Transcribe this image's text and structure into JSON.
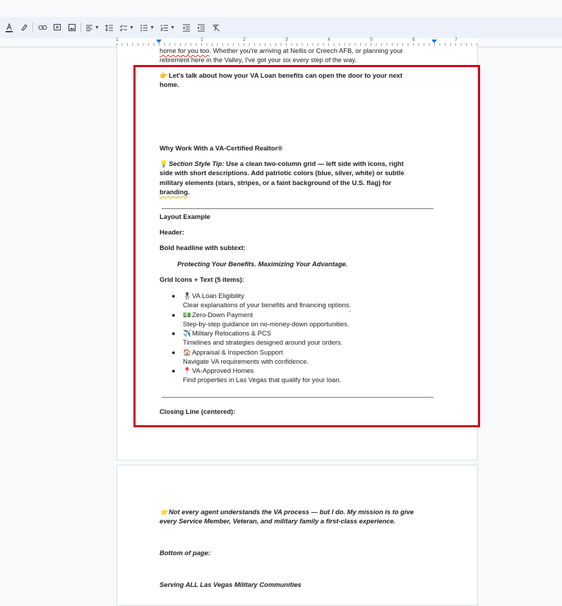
{
  "toolbar": {
    "items": [
      "text-color",
      "highlight",
      "link",
      "comment",
      "image",
      "align",
      "line-spacing",
      "checklist",
      "bulleted-list",
      "numbered-list",
      "decrease-indent",
      "increase-indent",
      "clear-formatting"
    ]
  },
  "ruler": {
    "numbers": [
      "1",
      "1",
      "2",
      "3",
      "4",
      "5",
      "6",
      "7"
    ]
  },
  "doc": {
    "intro_line1_a": "home for you too",
    "intro_line1_b": ". Whether you're arriving at Nellis or Creech AFB, or planning your",
    "intro_line2": "retirement here in the Valley, I've got your six every step of the way.",
    "cta_emoji": "👉",
    "cta_line1": "Let's talk about how your VA Loan benefits can open the door to your next",
    "cta_line2": "home.",
    "why_heading": "Why Work With a VA-Certified Realtor®",
    "tip_emoji": "💡",
    "tip_label": "Section Style Tip:",
    "tip_line1": " Use a clean two-column grid — left side with icons, right",
    "tip_line2": "side with short descriptions. Add patriotic colors (blue, silver, white) or subtle",
    "tip_line3": "military elements (stars, stripes, or a faint background of the U.S. flag) for",
    "tip_line4_a": "branding",
    "tip_line4_b": ".",
    "layout_example": "Layout Example",
    "header_label": "Header:",
    "bold_headline_label": "Bold headline with subtext:",
    "subtext": "Protecting Your Benefits. Maximizing Your Advantage.",
    "grid_label": "Grid Icons + Text (5 items):",
    "grid_items": [
      {
        "emoji": "🎖",
        "title": "VA Loan Eligibility",
        "desc": "Clear explanations of your benefits and financing options",
        "desc_end": "."
      },
      {
        "emoji": "💵",
        "title": "Zero-Down Payment",
        "desc": "Step-by-step guidance on no-money-down opportunities.",
        "desc_end": ""
      },
      {
        "emoji": "✈️",
        "title": "Military Relocations & PCS",
        "desc": "Timelines and strategies designed around your orders.",
        "desc_end": ""
      },
      {
        "emoji": "🏠",
        "title": "Appraisal & Inspection Support",
        "desc": "Navigate VA requirements with confidence.",
        "desc_end": ""
      },
      {
        "emoji": "📍",
        "title": "VA-Approved Homes",
        "desc": "Find properties in Las Vegas that qualify for your loan.",
        "desc_end": ""
      }
    ],
    "closing_label": "Closing Line (centered):",
    "page2_emoji": "⭐",
    "page2_line1": "Not every agent understands the VA process — but I do. My mission is to give",
    "page2_line2": "every Service Member, Veteran, and military family a first-class experience.",
    "bottom_label": "Bottom of page:",
    "serving": "Serving ALL Las Vegas Military Communities"
  },
  "colors": {
    "highlight_box": "#d0021b",
    "toolbar_bg": "#edf2fa",
    "ruler_marker": "#1a73e8"
  }
}
